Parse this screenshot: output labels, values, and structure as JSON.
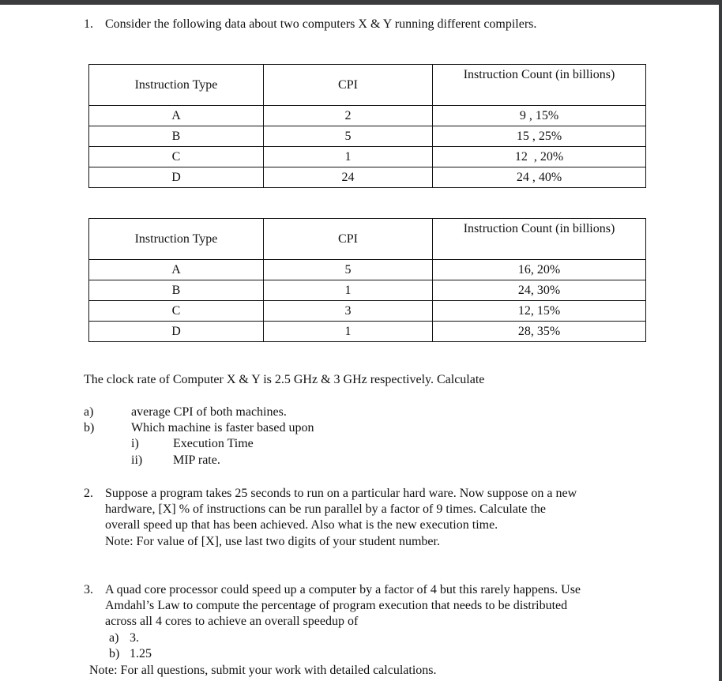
{
  "q1": {
    "number": "1.",
    "intro": "Consider the following data about two computers X & Y running different compilers.",
    "headers": [
      "Instruction Type",
      "CPI",
      "Instruction Count (in billions)"
    ],
    "table_x": [
      [
        "A",
        "2",
        "9 , 15%"
      ],
      [
        "B",
        "5",
        "15 , 25%"
      ],
      [
        "C",
        "1",
        "12  , 20%"
      ],
      [
        "D",
        "24",
        "24 , 40%"
      ]
    ],
    "table_y": [
      [
        "A",
        "5",
        "16, 20%"
      ],
      [
        "B",
        "1",
        "24, 30%"
      ],
      [
        "C",
        "3",
        "12, 15%"
      ],
      [
        "D",
        "1",
        "28, 35%"
      ]
    ],
    "clock": "The clock rate of Computer X & Y is 2.5 GHz & 3 GHz respectively. Calculate",
    "a_label": "a)",
    "a_text": "average CPI of both machines.",
    "b_label": "b)",
    "b_text": "Which machine is faster based upon",
    "bi_label": "i)",
    "bi_text": "Execution Time",
    "bii_label": "ii)",
    "bii_text": "MIP rate."
  },
  "q2": {
    "number": "2.",
    "lines": [
      "Suppose a program takes 25 seconds to run on a particular hard ware. Now suppose on a new",
      "hardware, [X] % of instructions can be run parallel by a factor of 9 times. Calculate the",
      "overall speed up that has been achieved. Also what is the new execution time.",
      "Note: For value of [X], use last two digits of your student number."
    ]
  },
  "q3": {
    "number": "3.",
    "lines": [
      "A quad core processor could speed up a computer by a factor of 4 but this rarely happens. Use",
      "Amdahl’s Law to compute the percentage of program execution that needs to be distributed",
      "across all 4 cores to achieve an overall speedup of"
    ],
    "a_label": "a)",
    "a_text": "3.",
    "b_label": "b)",
    "b_text": "1.25"
  },
  "final_note": "Note: For all questions, submit your work with detailed calculations."
}
